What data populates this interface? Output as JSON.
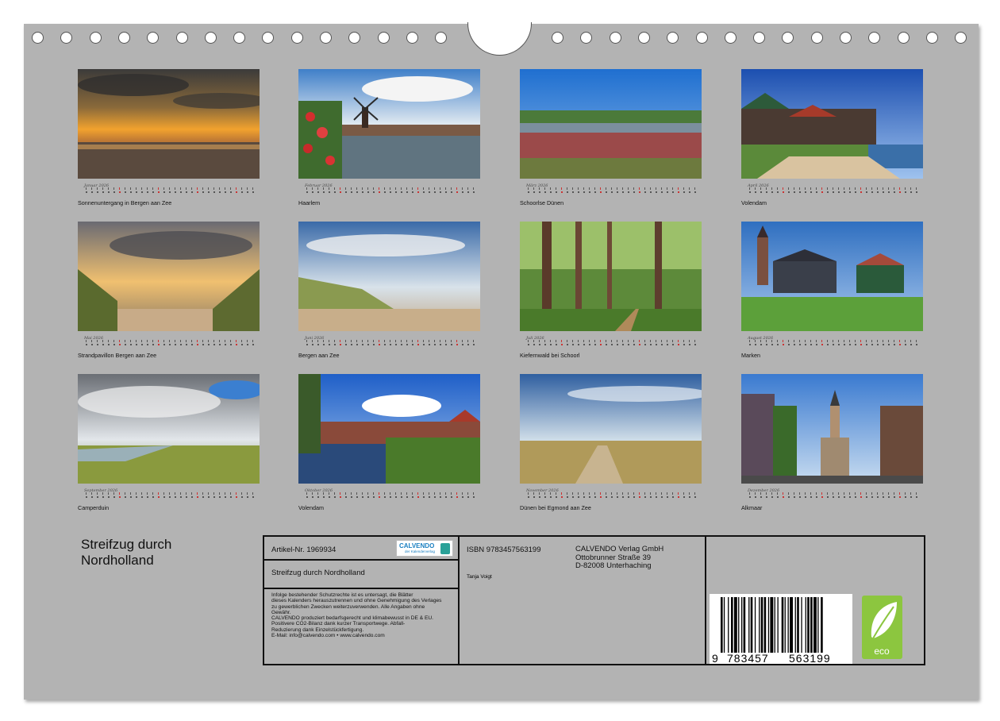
{
  "calendar": {
    "title_lines": [
      "Streifzug durch",
      "Nordholland"
    ],
    "months": [
      {
        "name": "Januar 2026",
        "caption": "Sonnenuntergang in Bergen aan Zee",
        "scene": "sunset-beach"
      },
      {
        "name": "Februar 2026",
        "caption": "Haarlem",
        "scene": "windmill-river"
      },
      {
        "name": "März 2026",
        "caption": "Schoorlse Dünen",
        "scene": "heath-lake"
      },
      {
        "name": "April 2026",
        "caption": "Volendam",
        "scene": "houses-shore"
      },
      {
        "name": "Mai 2026",
        "caption": "Strandpavillon Bergen aan Zee",
        "scene": "dunes-sunset"
      },
      {
        "name": "Juni 2026",
        "caption": "Bergen aan Zee",
        "scene": "dune-beach"
      },
      {
        "name": "Juli 2026",
        "caption": "Kiefernwald bei Schoorl",
        "scene": "pine-forest"
      },
      {
        "name": "August 2026",
        "caption": "Marken",
        "scene": "green-houses"
      },
      {
        "name": "September 2026",
        "caption": "Camperduin",
        "scene": "clouds-dunes"
      },
      {
        "name": "Oktober 2026",
        "caption": "Volendam",
        "scene": "canal-reflection"
      },
      {
        "name": "November 2026",
        "caption": "Dünen bei Egmond aan Zee",
        "scene": "dune-path"
      },
      {
        "name": "Dezember 2026",
        "caption": "Alkmaar",
        "scene": "town-tower"
      }
    ]
  },
  "info": {
    "article": "Artikel-Nr. 1969934",
    "subtitle": "Streifzug durch Nordholland",
    "legal_lines": [
      "Infolge bestehender Schutzrechte ist es untersagt, die Blätter",
      "dieses Kalenders herauszutrennen und ohne Genehmigung des Verlages",
      "zu gewerblichen Zwecken weiterzuverwenden. Alle Angaben ohne",
      "Gewähr.",
      "CALVENDO produziert bedarfsgerecht und klimabewusst in DE & EU.",
      "Positivere CO2-Bilanz dank kurzer Transportwege. Abfall-",
      "Reduzierung dank Einzelstückfertigung.",
      "E-Mail: info@calvendo.com • www.calvendo.com"
    ],
    "isbn": "ISBN 9783457563199",
    "publisher_lines": [
      "CALVENDO Verlag GmbH",
      "Ottobrunner Straße 39",
      "D-82008 Unterhaching"
    ],
    "author": "Tanja Voigt",
    "logo_text": "CALVENDO",
    "logo_sub": "der Kalenderverlag",
    "barcode_digits": [
      "9",
      "783457",
      "563199"
    ],
    "eco_label": "eco"
  },
  "colors": {
    "sheet": "#b3b3b3",
    "eco_green": "#8cc63f",
    "logo_blue": "#1a7fc1"
  }
}
